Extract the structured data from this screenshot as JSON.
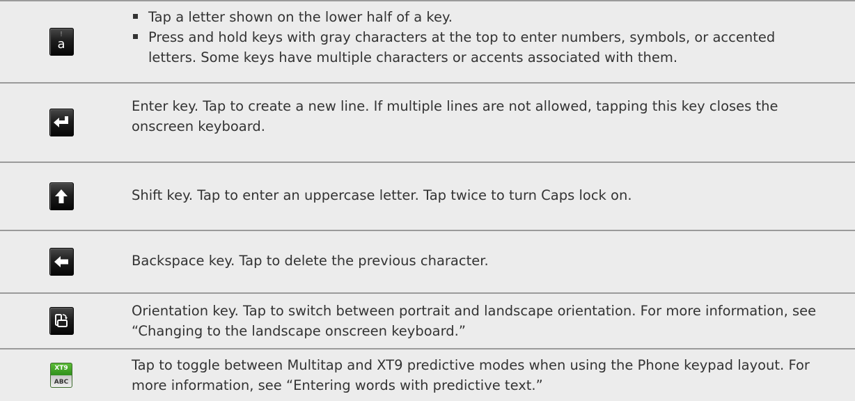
{
  "rows": [
    {
      "icon": "letter-key-icon",
      "icon_top_char": "!",
      "icon_main_char": "a",
      "bullets": [
        "Tap a letter shown on the lower half of a key.",
        "Press and hold keys with gray characters at the top to enter numbers, symbols, or accented letters. Some keys have multiple characters or accents associated with them."
      ]
    },
    {
      "icon": "enter-key-icon",
      "keyword": "Enter",
      "text": " key. Tap to create a new line. If multiple lines are not allowed, tapping this key closes the onscreen keyboard."
    },
    {
      "icon": "shift-key-icon",
      "keyword": "Shift",
      "text": " key. Tap to enter an uppercase letter. Tap twice to turn Caps lock on."
    },
    {
      "icon": "backspace-key-icon",
      "keyword": "Backspace",
      "text": " key. Tap to delete the previous character."
    },
    {
      "icon": "orientation-key-icon",
      "keyword": "Orientation",
      "text": " key. Tap to switch between portrait and landscape orientation. For more information, see “Changing to the landscape onscreen keyboard.”"
    },
    {
      "icon": "xt9-abc-key-icon",
      "icon_top_label": "XT9",
      "icon_bottom_label": "ABC",
      "text": "Tap to toggle between Multitap and XT9 predictive modes when using the Phone keypad layout. For more information, see “Entering words with predictive text.”"
    }
  ],
  "colors": {
    "row_background": "#ececec",
    "rule": "#9a9a9a",
    "text": "#333333",
    "key_dark": "#1e1e1e",
    "xt9_green": "#2f8f1b"
  }
}
